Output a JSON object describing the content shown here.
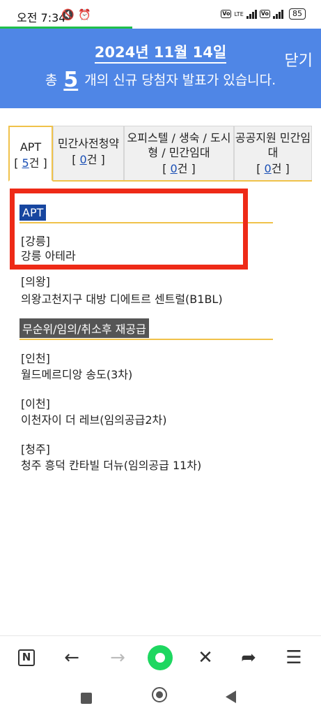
{
  "status_bar": {
    "time": "오전 7:34",
    "battery": "85",
    "lte_label": "LTE"
  },
  "header": {
    "date": "2024년 11월 14일",
    "close_label": "닫기",
    "subtitle_pre": "총",
    "count": "5",
    "subtitle_post": "개의 신규 당첨자 발표가 있습니다."
  },
  "tabs": [
    {
      "label": "APT",
      "count_pre": "[ ",
      "count": "5",
      "count_post": "건 ]"
    },
    {
      "label": "민간사전청약",
      "count_pre": "[ ",
      "count": "0",
      "count_post": "건 ]"
    },
    {
      "label": "오피스텔 / 생숙 / 도시형 / 민간임대",
      "count_pre": "[ ",
      "count": "0",
      "count_post": "건 ]"
    },
    {
      "label": "공공지원 민간임대",
      "count_pre": "[ ",
      "count": "0",
      "count_post": "건 ]"
    }
  ],
  "sections": [
    {
      "title": "APT",
      "items": [
        {
          "region": "[강릉]",
          "name": "강릉 아테라"
        },
        {
          "region": "[의왕]",
          "name": "의왕고천지구 대방 디에트르 센트럴(B1BL)"
        }
      ]
    },
    {
      "title": "무순위/임의/취소후 재공급",
      "items": [
        {
          "region": "[인천]",
          "name": "월드메르디앙 송도(3차)"
        },
        {
          "region": "[이천]",
          "name": "이천자이 더 레브(임의공급2차)"
        },
        {
          "region": "[청주]",
          "name": "청주 흥덕 칸타빌 더뉴(임의공급 11차)"
        }
      ]
    }
  ],
  "browser_nav": {
    "n_label": "N",
    "back": "←",
    "forward": "→",
    "close": "✕",
    "share": "➦",
    "menu": "☰"
  },
  "colors": {
    "header_blue": "#4f86e6",
    "accent_yellow": "#f0c24a",
    "highlight_red": "#ee2a17",
    "section_blue": "#1746a0"
  }
}
